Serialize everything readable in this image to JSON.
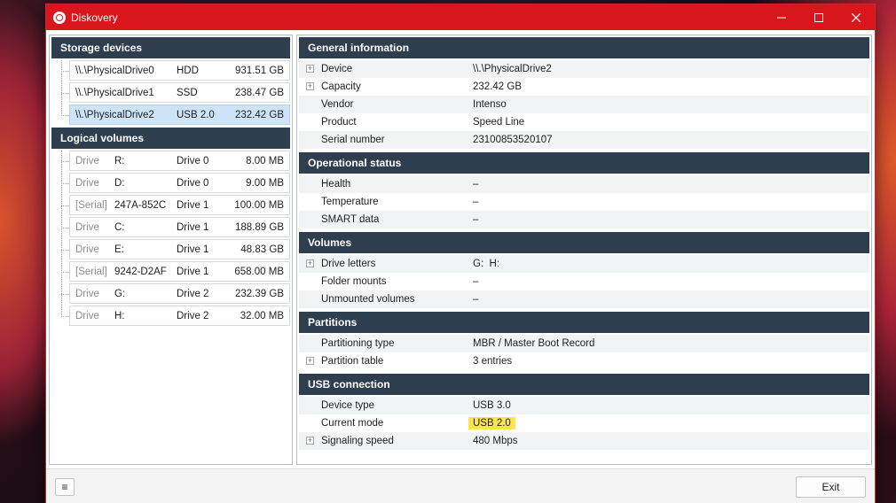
{
  "window": {
    "title": "Diskovery",
    "controls": {
      "minimize_icon": "minimize-icon",
      "maximize_icon": "maximize-icon",
      "close_icon": "close-icon"
    }
  },
  "storage": {
    "header": "Storage devices",
    "items": [
      {
        "name": "\\\\.\\PhysicalDrive0",
        "type": "HDD",
        "size": "931.51 GB"
      },
      {
        "name": "\\\\.\\PhysicalDrive1",
        "type": "SSD",
        "size": "238.47 GB"
      },
      {
        "name": "\\\\.\\PhysicalDrive2",
        "type": "USB 2.0",
        "size": "232.42 GB"
      }
    ]
  },
  "volumes": {
    "header": "Logical volumes",
    "items": [
      {
        "kind": "Drive",
        "id": "R:",
        "drive": "Drive 0",
        "size": "8.00 MB"
      },
      {
        "kind": "Drive",
        "id": "D:",
        "drive": "Drive 0",
        "size": "9.00 MB"
      },
      {
        "kind": "[Serial]",
        "id": "247A-852C",
        "drive": "Drive 1",
        "size": "100.00 MB"
      },
      {
        "kind": "Drive",
        "id": "C:",
        "drive": "Drive 1",
        "size": "188.89 GB"
      },
      {
        "kind": "Drive",
        "id": "E:",
        "drive": "Drive 1",
        "size": "48.83 GB"
      },
      {
        "kind": "[Serial]",
        "id": "9242-D2AF",
        "drive": "Drive 1",
        "size": "658.00 MB"
      },
      {
        "kind": "Drive",
        "id": "G:",
        "drive": "Drive 2",
        "size": "232.39 GB"
      },
      {
        "kind": "Drive",
        "id": "H:",
        "drive": "Drive 2",
        "size": "32.00 MB"
      }
    ]
  },
  "details": {
    "general": {
      "header": "General information",
      "rows": [
        {
          "key": "Device",
          "value": "\\\\.\\PhysicalDrive2",
          "expandable": true
        },
        {
          "key": "Capacity",
          "value": "232.42 GB",
          "expandable": true
        },
        {
          "key": "Vendor",
          "value": "Intenso",
          "expandable": false
        },
        {
          "key": "Product",
          "value": "Speed Line",
          "expandable": false
        },
        {
          "key": "Serial number",
          "value": "23100853520107",
          "expandable": false
        }
      ]
    },
    "status": {
      "header": "Operational status",
      "rows": [
        {
          "key": "Health",
          "value": "–"
        },
        {
          "key": "Temperature",
          "value": "–"
        },
        {
          "key": "SMART data",
          "value": "–"
        }
      ]
    },
    "volumes": {
      "header": "Volumes",
      "rows": [
        {
          "key": "Drive letters",
          "value": "G:  H:",
          "expandable": true
        },
        {
          "key": "Folder mounts",
          "value": "–"
        },
        {
          "key": "Unmounted volumes",
          "value": "–"
        }
      ]
    },
    "partitions": {
      "header": "Partitions",
      "rows": [
        {
          "key": "Partitioning type",
          "value": "MBR / Master Boot Record"
        },
        {
          "key": "Partition table",
          "value": "3 entries",
          "expandable": true
        }
      ]
    },
    "usb": {
      "header": "USB connection",
      "rows": [
        {
          "key": "Device type",
          "value": "USB 3.0"
        },
        {
          "key": "Current mode",
          "value": "USB 2.0",
          "highlight": "#fbe54b"
        },
        {
          "key": "Signaling speed",
          "value": "480 Mbps",
          "expandable": true
        }
      ]
    }
  },
  "footer": {
    "menu_icon": "hamburger-icon",
    "menu_glyph": "≡",
    "exit_label": "Exit"
  },
  "colors": {
    "titlebar": "#d8161c",
    "section_header": "#2f3e4f",
    "selected_row": "#cde3f7",
    "highlight": "#fbe54b"
  }
}
